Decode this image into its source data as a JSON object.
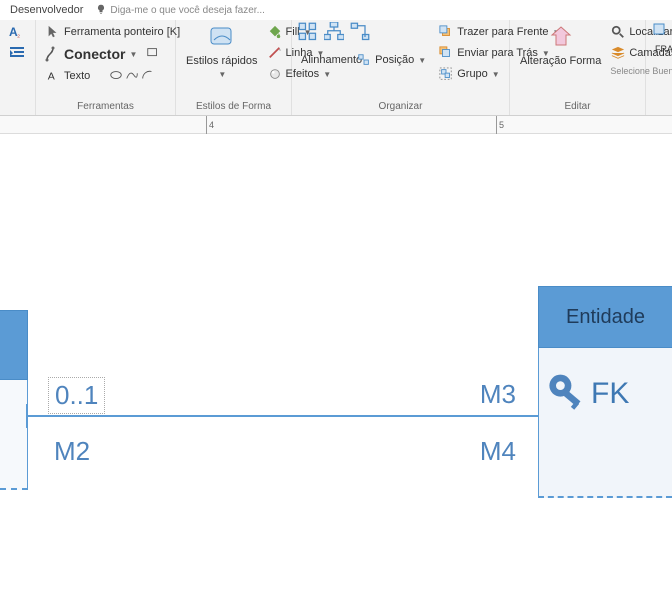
{
  "tab": {
    "developer": "Desenvolvedor",
    "tell_me": "Diga-me o que você deseja fazer..."
  },
  "ribbon": {
    "tools": {
      "pointer": "Ferramenta ponteiro [K]",
      "connector": "Conector",
      "text": "Texto",
      "label": "Ferramentas"
    },
    "shape_styles": {
      "quick": "Estilos rápidos",
      "fill": "Fill",
      "line": "Linha",
      "effects": "Efeitos",
      "label": "Estilos de Forma"
    },
    "arrange": {
      "align": "Alinhamento",
      "position": "Posição",
      "bring_front": "Trazer para Frente",
      "send_back": "Enviar para Trás",
      "group": "Grupo",
      "label": "Organizar"
    },
    "edit": {
      "change_shape": "Alteração Forma",
      "find": "Localizar",
      "layers": "Camadas",
      "select": "Selecione Bueno",
      "label": "Editar"
    },
    "frag": "FRA"
  },
  "ruler": {
    "r4": "4",
    "r5": "5"
  },
  "diagram": {
    "entity_title": "Entidade",
    "fk": "FK",
    "mult_01": "0..1",
    "mult_m2": "M2",
    "mult_m3": "M3",
    "mult_m4": "M4"
  }
}
